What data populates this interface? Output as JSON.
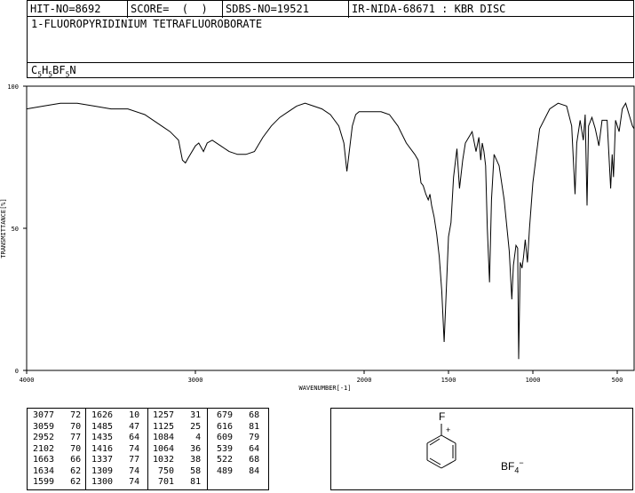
{
  "header": {
    "hit_no": "HIT-NO=8692",
    "score": "SCORE=  (  )",
    "sdbs_no": "SDBS-NO=19521",
    "ir_source": "IR-NIDA-68671 : KBR DISC"
  },
  "compound_name": "1-FLUOROPYRIDINIUM TETRAFLUOROBORATE",
  "formula": {
    "parts": [
      {
        "t": "C",
        "sub": false
      },
      {
        "t": "5",
        "sub": true
      },
      {
        "t": "H",
        "sub": false
      },
      {
        "t": "5",
        "sub": true
      },
      {
        "t": "BF",
        "sub": false
      },
      {
        "t": "5",
        "sub": true
      },
      {
        "t": "N",
        "sub": false
      }
    ]
  },
  "chart_data": {
    "type": "line",
    "xlabel": "WAVENUMBER[-1]",
    "ylabel": "TRANSMITTANCE[%]",
    "xlim": [
      4000,
      400
    ],
    "ylim": [
      0,
      100
    ],
    "xticks": [
      4000,
      3000,
      2000,
      1500,
      1000,
      500
    ],
    "yticks": [
      0,
      50,
      100
    ],
    "grid": false,
    "series": [
      {
        "x": [
          4000,
          3900,
          3800,
          3700,
          3600,
          3500,
          3400,
          3300,
          3200,
          3150,
          3100,
          3077,
          3059,
          3040,
          3000,
          2980,
          2952,
          2930,
          2900,
          2850,
          2800,
          2750,
          2700,
          2650,
          2600,
          2550,
          2500,
          2450,
          2400,
          2350,
          2300,
          2250,
          2200,
          2150,
          2120,
          2102,
          2090,
          2070,
          2050,
          2030,
          2010,
          1990,
          1950,
          1900,
          1850,
          1800,
          1750,
          1700,
          1680,
          1663,
          1650,
          1634,
          1620,
          1610,
          1600,
          1585,
          1570,
          1555,
          1540,
          1526,
          1515,
          1500,
          1485,
          1470,
          1450,
          1435,
          1416,
          1400,
          1380,
          1360,
          1337,
          1320,
          1309,
          1300,
          1290,
          1280,
          1270,
          1257,
          1245,
          1230,
          1200,
          1170,
          1140,
          1125,
          1115,
          1100,
          1090,
          1084,
          1075,
          1064,
          1055,
          1045,
          1032,
          1020,
          1000,
          960,
          900,
          850,
          800,
          770,
          750,
          740,
          720,
          701,
          690,
          679,
          670,
          650,
          630,
          616,
          609,
          590,
          560,
          539,
          530,
          522,
          510,
          489,
          470,
          450,
          430,
          410,
          400
        ],
        "y": [
          92,
          93,
          94,
          94,
          93,
          92,
          92,
          90,
          86,
          84,
          81,
          74,
          73,
          75,
          79,
          80,
          77,
          80,
          81,
          79,
          77,
          76,
          76,
          77,
          82,
          86,
          89,
          91,
          93,
          94,
          93,
          92,
          90,
          86,
          80,
          70,
          76,
          86,
          90,
          91,
          91,
          91,
          91,
          91,
          90,
          86,
          80,
          76,
          74,
          66,
          65,
          62,
          60,
          62,
          58,
          54,
          48,
          40,
          28,
          10,
          25,
          47,
          52,
          68,
          78,
          64,
          74,
          80,
          82,
          84,
          77,
          82,
          74,
          80,
          77,
          72,
          50,
          31,
          60,
          76,
          72,
          60,
          42,
          25,
          37,
          44,
          43,
          4,
          38,
          36,
          40,
          46,
          38,
          50,
          66,
          85,
          92,
          94,
          93,
          86,
          62,
          80,
          88,
          81,
          90,
          58,
          86,
          89,
          85,
          81,
          79,
          88,
          88,
          64,
          76,
          68,
          88,
          84,
          92,
          94,
          90,
          86,
          85
        ]
      }
    ]
  },
  "peaks": [
    [
      [
        "3077",
        "72"
      ],
      [
        "3059",
        "70"
      ],
      [
        "2952",
        "77"
      ],
      [
        "2102",
        "70"
      ],
      [
        "1663",
        "66"
      ],
      [
        "1634",
        "62"
      ],
      [
        "1599",
        "62"
      ]
    ],
    [
      [
        "1626",
        "10"
      ],
      [
        "1485",
        "47"
      ],
      [
        "1435",
        "64"
      ],
      [
        "1416",
        "74"
      ],
      [
        "1337",
        "77"
      ],
      [
        "1309",
        "74"
      ],
      [
        "1300",
        "74"
      ]
    ],
    [
      [
        "1257",
        "31"
      ],
      [
        "1125",
        "25"
      ],
      [
        "1084",
        "4"
      ],
      [
        "1064",
        "36"
      ],
      [
        "1032",
        "38"
      ],
      [
        "750",
        "58"
      ],
      [
        "701",
        "81"
      ]
    ],
    [
      [
        "679",
        "68"
      ],
      [
        "616",
        "81"
      ],
      [
        "609",
        "79"
      ],
      [
        "539",
        "64"
      ],
      [
        "522",
        "68"
      ],
      [
        "489",
        "84"
      ]
    ]
  ],
  "structure": {
    "fluorine": "F",
    "charge_plus": "+",
    "anion_base": "BF",
    "anion_sub": "4",
    "anion_charge": "−"
  },
  "colors": {
    "ink": "#000000",
    "background": "#ffffff"
  }
}
